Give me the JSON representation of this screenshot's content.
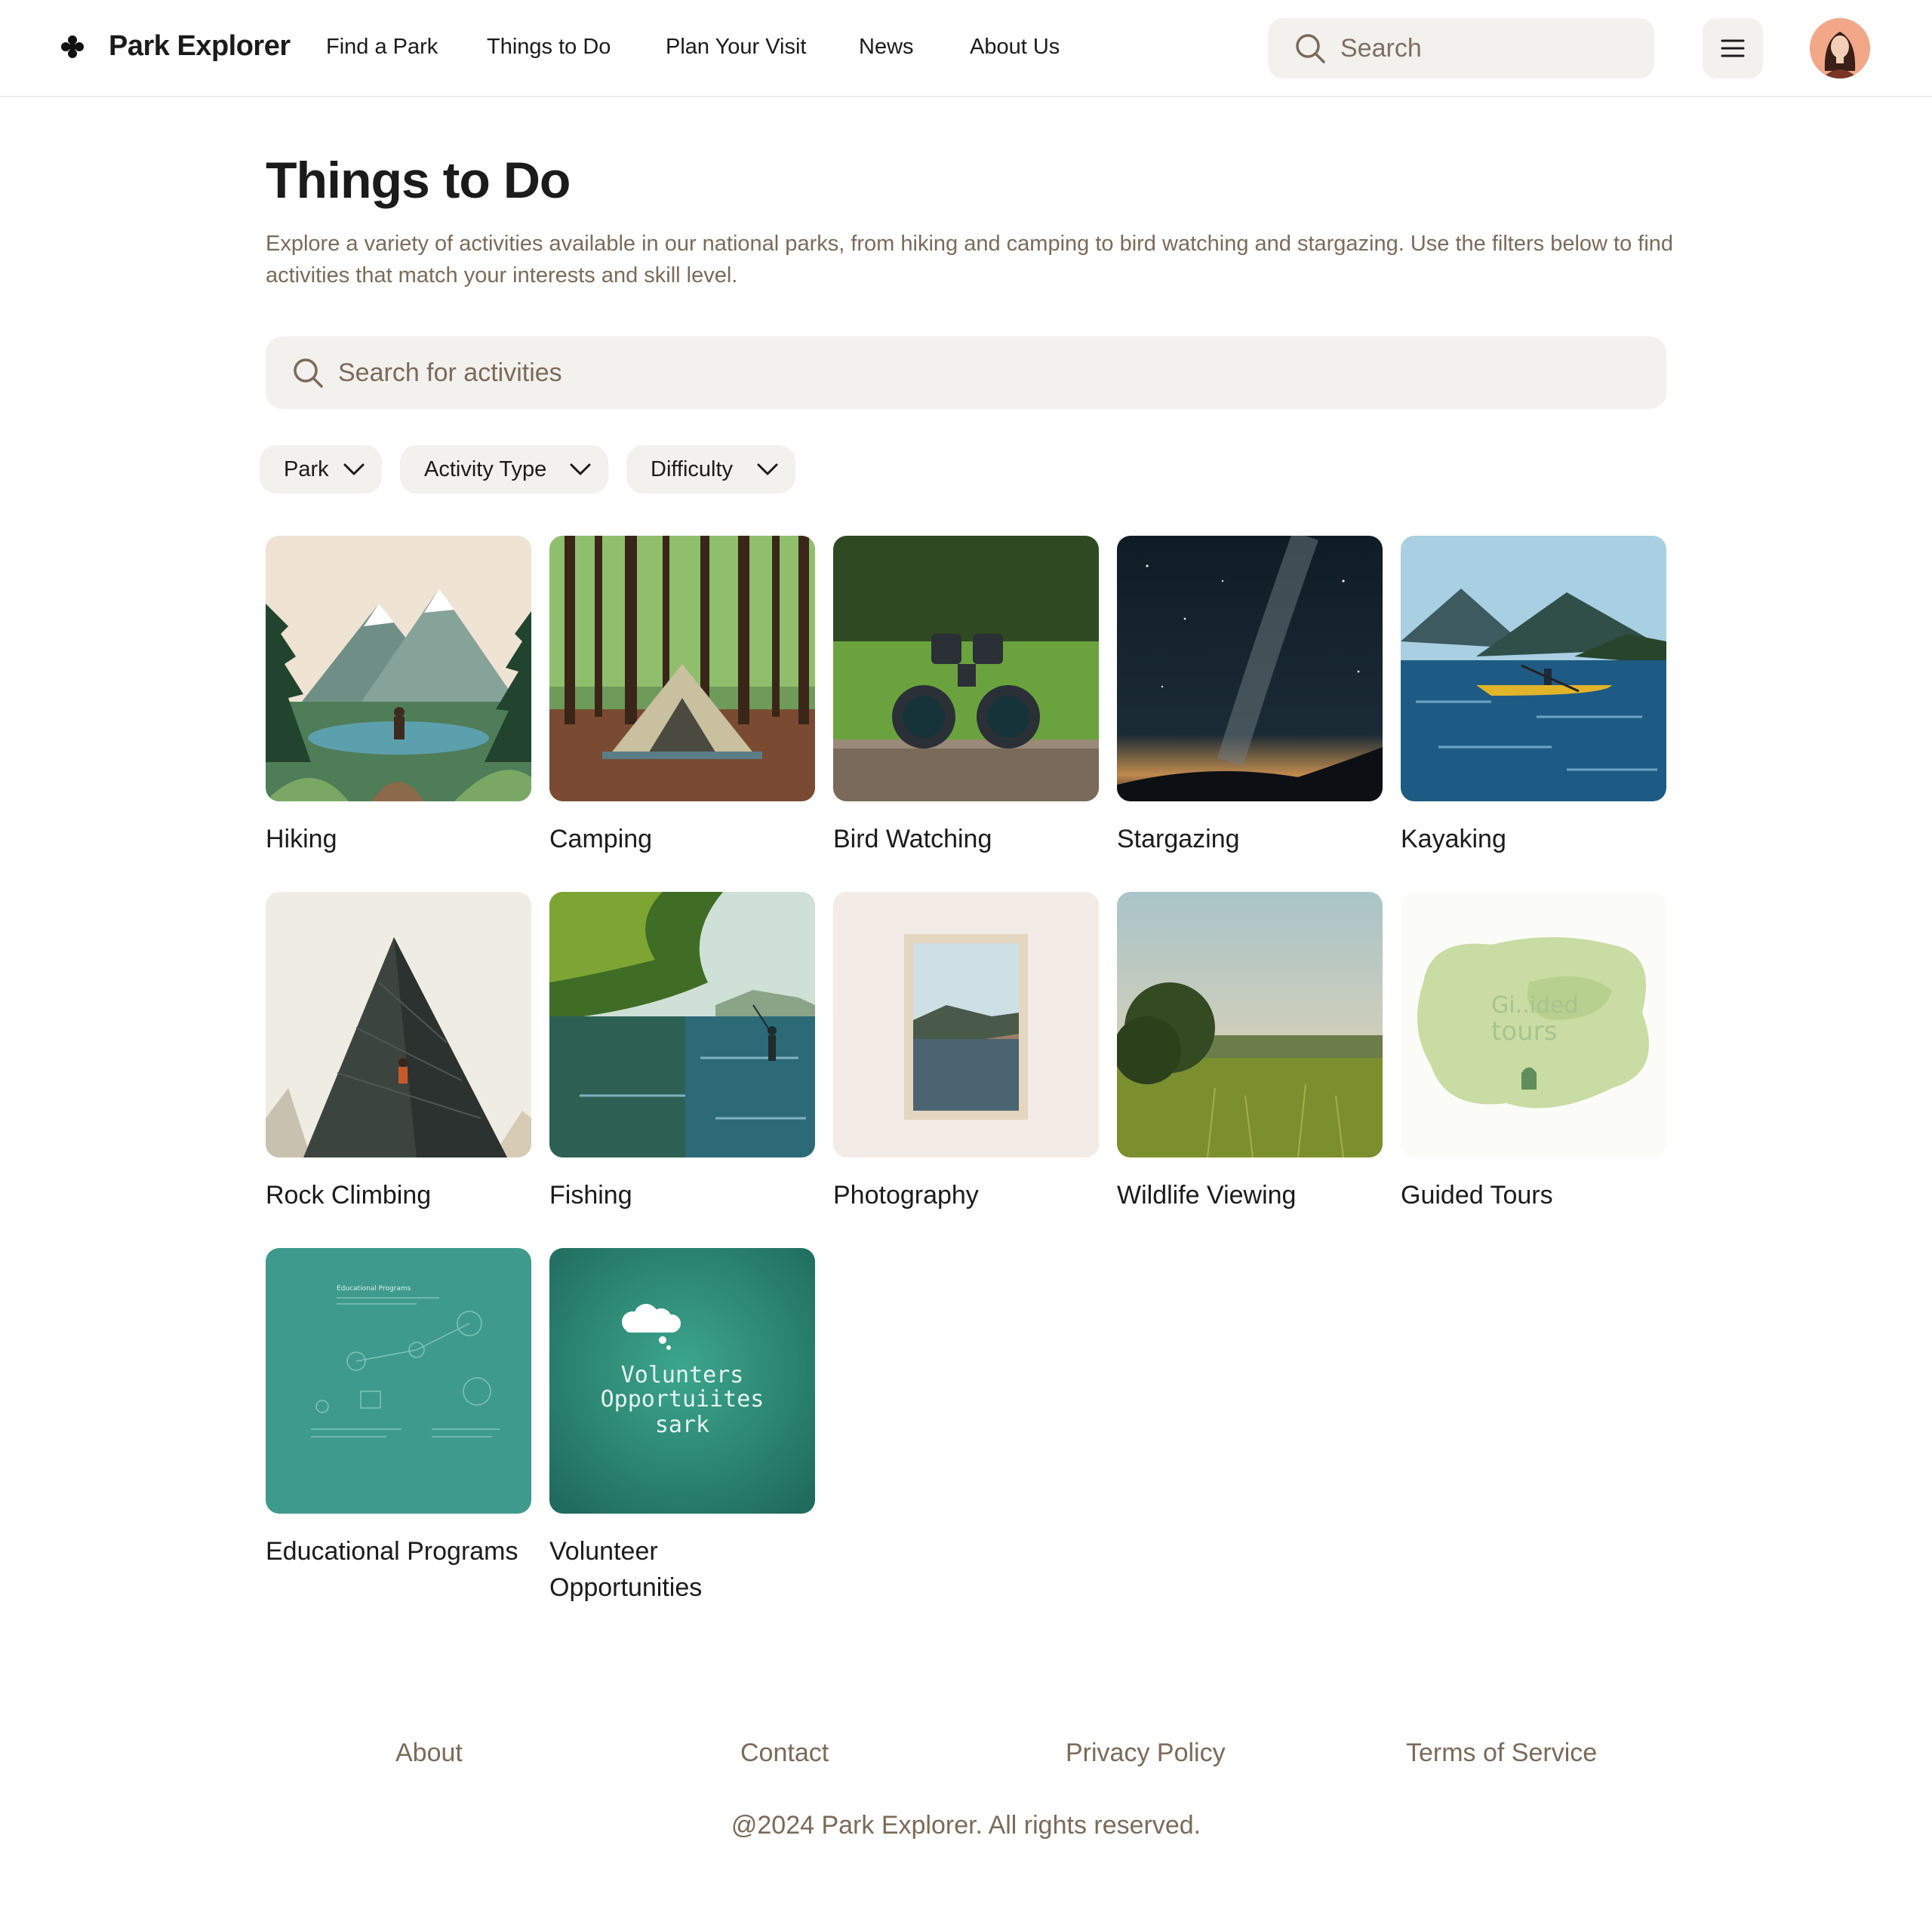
{
  "header": {
    "brand": "Park Explorer",
    "nav": [
      "Find a Park",
      "Things to Do",
      "Plan Your Visit",
      "News",
      "About Us"
    ],
    "search_placeholder": "Search"
  },
  "main": {
    "title": "Things to Do",
    "description": "Explore a variety of activities available in our national parks, from hiking and camping to bird watching and stargazing. Use the filters below to find activities that match your interests and skill level.",
    "search_placeholder": "Search for activities",
    "filters": [
      "Park",
      "Activity Type",
      "Difficulty"
    ],
    "activities": [
      "Hiking",
      "Camping",
      "Bird Watching",
      "Stargazing",
      "Kayaking",
      "Rock Climbing",
      "Fishing",
      "Photography",
      "Wildlife Viewing",
      "Guided Tours",
      "Educational Programs",
      "Volunteer Opportunities"
    ],
    "thumb_text": {
      "educational": "Educational Programs",
      "volunteer": [
        "Volunters",
        "Opportuiites",
        "sark"
      ],
      "guided": [
        "Gi..ided",
        "tours"
      ]
    }
  },
  "footer": {
    "links": [
      "About",
      "Contact",
      "Privacy Policy",
      "Terms of Service"
    ],
    "copyright": "@2024 Park Explorer. All rights reserved."
  },
  "icons": {
    "logo": "flower-icon",
    "search": "search-icon",
    "menu": "menu-icon",
    "chevron": "chevron-down-icon"
  },
  "colors": {
    "muted_text": "#7b6a59",
    "input_bg": "#f3f1ee",
    "divider": "#ececec"
  }
}
